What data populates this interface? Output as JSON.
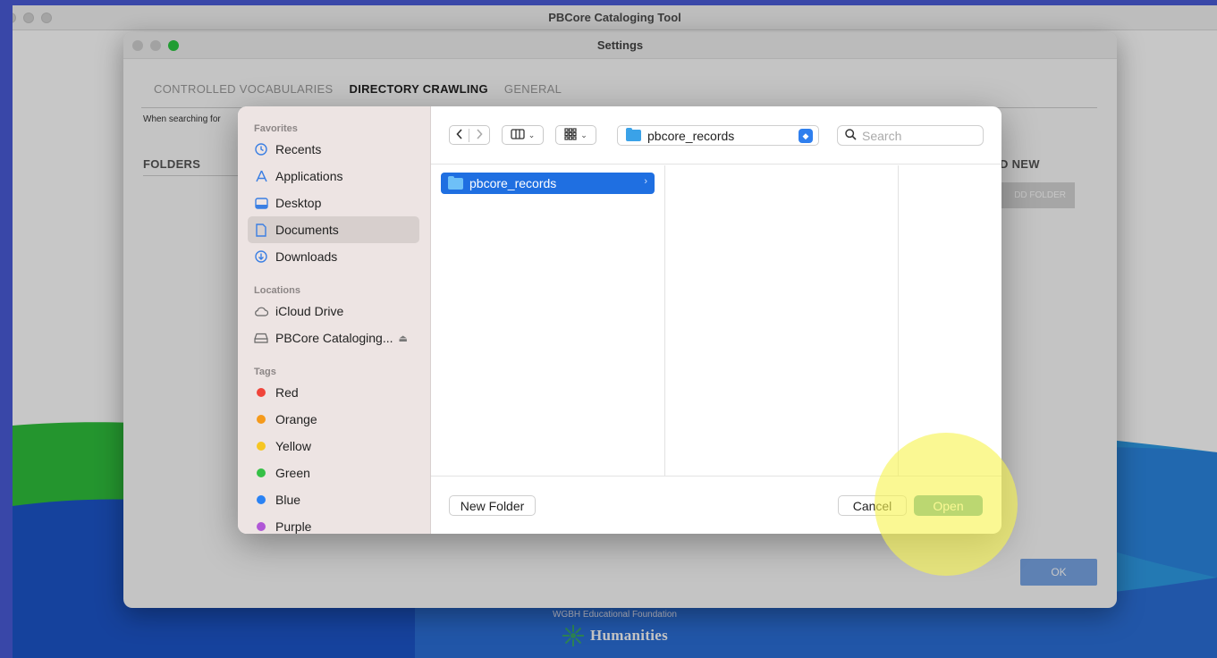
{
  "app": {
    "title": "PBCore Cataloging Tool",
    "footer_org": "WGBH Educational Foundation",
    "footer_logo_text": "Humanities"
  },
  "settings": {
    "title": "Settings",
    "tabs": [
      {
        "label": "CONTROLLED VOCABULARIES",
        "active": false
      },
      {
        "label": "DIRECTORY CRAWLING",
        "active": true
      },
      {
        "label": "GENERAL",
        "active": false
      }
    ],
    "hint": "When searching for",
    "folders_label": "FOLDERS",
    "add_new_label": "D NEW",
    "add_folder_button": "DD FOLDER",
    "ok_button": "OK"
  },
  "dialog": {
    "sidebar": {
      "favorites_heading": "Favorites",
      "favorites": [
        {
          "label": "Recents",
          "icon": "clock-icon"
        },
        {
          "label": "Applications",
          "icon": "applications-icon"
        },
        {
          "label": "Desktop",
          "icon": "desktop-icon"
        },
        {
          "label": "Documents",
          "icon": "document-icon",
          "selected": true
        },
        {
          "label": "Downloads",
          "icon": "download-icon"
        }
      ],
      "locations_heading": "Locations",
      "locations": [
        {
          "label": "iCloud Drive",
          "icon": "cloud-icon"
        },
        {
          "label": "PBCore Cataloging...",
          "icon": "disk-icon",
          "eject": true
        }
      ],
      "tags_heading": "Tags",
      "tags": [
        {
          "label": "Red",
          "color": "#f0443a"
        },
        {
          "label": "Orange",
          "color": "#f59a1b"
        },
        {
          "label": "Yellow",
          "color": "#f6c623"
        },
        {
          "label": "Green",
          "color": "#35c046"
        },
        {
          "label": "Blue",
          "color": "#2a82f4"
        },
        {
          "label": "Purple",
          "color": "#b057d6"
        }
      ]
    },
    "toolbar": {
      "back_icon": "chevron-left-icon",
      "forward_icon": "chevron-right-icon",
      "view_icon": "columns-view-icon",
      "group_icon": "grid-view-icon",
      "path_folder": "pbcore_records",
      "search_placeholder": "Search"
    },
    "browser": {
      "items": [
        {
          "label": "pbcore_records",
          "selected": true
        }
      ]
    },
    "footer": {
      "new_folder": "New Folder",
      "cancel": "Cancel",
      "open": "Open"
    }
  },
  "colors": {
    "accent_blue": "#1f6fe1",
    "open_button": "#5aa9a7",
    "desktop_bg": "#4a5bd8",
    "highlight": "#f7f450"
  }
}
